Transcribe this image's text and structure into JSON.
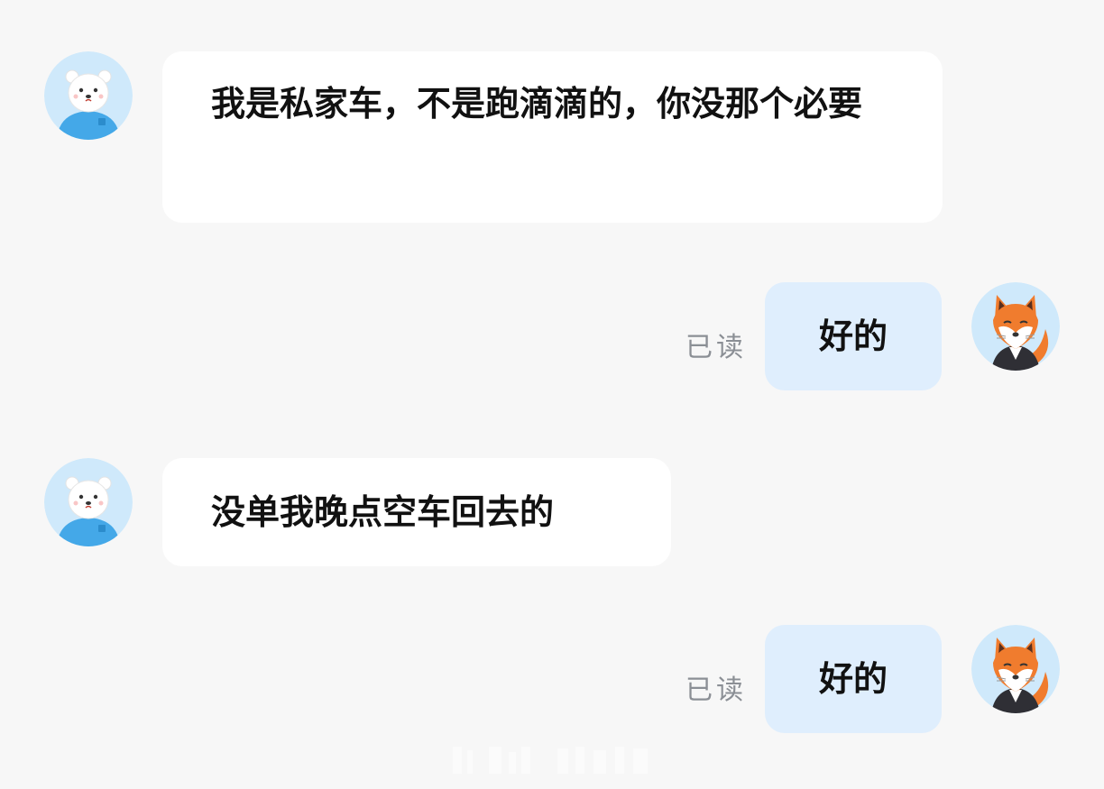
{
  "messages": [
    {
      "side": "left",
      "sender": "polar-bear",
      "text": "我是私家车，不是跑滴滴的，你没那个必要"
    },
    {
      "side": "right",
      "sender": "fox",
      "text": "好的",
      "status": "已读"
    },
    {
      "side": "left",
      "sender": "polar-bear",
      "text": "没单我晚点空车回去的"
    },
    {
      "side": "right",
      "sender": "fox",
      "text": "好的",
      "status": "已读"
    }
  ],
  "colors": {
    "background": "#f7f7f7",
    "incoming_bubble": "#ffffff",
    "outgoing_bubble": "#dfeefd",
    "read_status": "#8b8f95",
    "avatar_bg": "#cfe9fb"
  },
  "icons": {
    "incoming_avatar": "polar-bear-avatar-icon",
    "outgoing_avatar": "fox-avatar-icon"
  }
}
